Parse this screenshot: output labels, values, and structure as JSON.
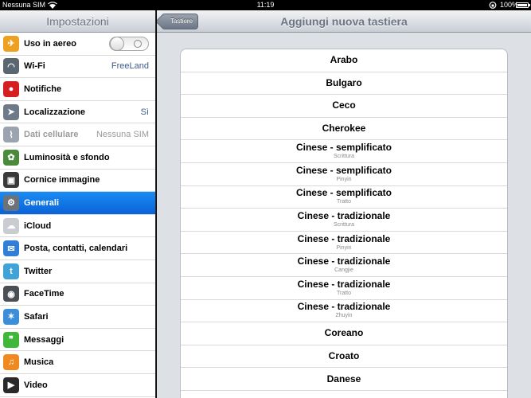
{
  "status": {
    "carrier": "Nessuna SIM",
    "time": "11:19",
    "battery": "100%",
    "battery_level": 1.0
  },
  "master": {
    "title": "Impostazioni",
    "items": [
      {
        "label": "Uso in aereo",
        "icon": "airplane-icon",
        "icon_color": "#f0a020",
        "value": "",
        "toggle": true,
        "toggle_on": false
      },
      {
        "label": "Wi-Fi",
        "icon": "wifi-icon",
        "icon_color": "#5a6670",
        "value": "FreeLand"
      },
      {
        "label": "Notifiche",
        "icon": "notifications-icon",
        "icon_color": "#d42020",
        "value": ""
      },
      {
        "label": "Localizzazione",
        "icon": "location-icon",
        "icon_color": "#6f7a88",
        "value": "Sì"
      },
      {
        "label": "Dati cellulare",
        "icon": "cellular-icon",
        "icon_color": "#9aa3ae",
        "value": "Nessuna SIM",
        "disabled": true
      },
      {
        "label": "Luminosità e sfondo",
        "icon": "brightness-icon",
        "icon_color": "#4a8a3a",
        "value": ""
      },
      {
        "label": "Cornice immagine",
        "icon": "picture-frame-icon",
        "icon_color": "#3a3a3a",
        "value": ""
      },
      {
        "label": "Generali",
        "icon": "gear-icon",
        "icon_color": "#6b727a",
        "value": "",
        "selected": true
      },
      {
        "label": "iCloud",
        "icon": "icloud-icon",
        "icon_color": "#c9ccd1",
        "value": ""
      },
      {
        "label": "Posta, contatti, calendari",
        "icon": "mail-icon",
        "icon_color": "#2f7fd8",
        "value": ""
      },
      {
        "label": "Twitter",
        "icon": "twitter-icon",
        "icon_color": "#3fa3d8",
        "value": ""
      },
      {
        "label": "FaceTime",
        "icon": "facetime-icon",
        "icon_color": "#4a4f55",
        "value": ""
      },
      {
        "label": "Safari",
        "icon": "safari-icon",
        "icon_color": "#3c8ed8",
        "value": ""
      },
      {
        "label": "Messaggi",
        "icon": "messages-icon",
        "icon_color": "#3fb83a",
        "value": ""
      },
      {
        "label": "Musica",
        "icon": "music-icon",
        "icon_color": "#f08a20",
        "value": ""
      },
      {
        "label": "Video",
        "icon": "video-icon",
        "icon_color": "#2a2a2a",
        "value": ""
      }
    ]
  },
  "detail": {
    "back_label": "Tastiere",
    "title": "Aggiungi nuova tastiera",
    "keyboards": [
      {
        "name": "Arabo",
        "sub": ""
      },
      {
        "name": "Bulgaro",
        "sub": ""
      },
      {
        "name": "Ceco",
        "sub": ""
      },
      {
        "name": "Cherokee",
        "sub": ""
      },
      {
        "name": "Cinese - semplificato",
        "sub": "Scrittura"
      },
      {
        "name": "Cinese - semplificato",
        "sub": "Pinyin"
      },
      {
        "name": "Cinese - semplificato",
        "sub": "Tratto"
      },
      {
        "name": "Cinese - tradizionale",
        "sub": "Scrittura"
      },
      {
        "name": "Cinese - tradizionale",
        "sub": "Pinyin"
      },
      {
        "name": "Cinese - tradizionale",
        "sub": "Cangjie"
      },
      {
        "name": "Cinese - tradizionale",
        "sub": "Tratto"
      },
      {
        "name": "Cinese - tradizionale",
        "sub": "Zhuyin"
      },
      {
        "name": "Coreano",
        "sub": ""
      },
      {
        "name": "Croato",
        "sub": ""
      },
      {
        "name": "Danese",
        "sub": ""
      },
      {
        "name": "",
        "sub": ""
      }
    ]
  }
}
